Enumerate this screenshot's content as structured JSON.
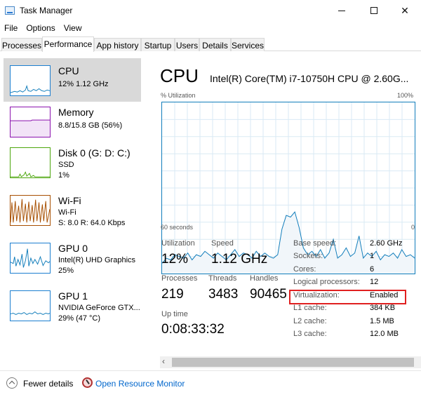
{
  "window": {
    "title": "Task Manager",
    "minimize_glyph": "minimize-icon",
    "maximize_glyph": "maximize-icon",
    "close_symbol": "✕"
  },
  "menu": [
    "File",
    "Options",
    "View"
  ],
  "tabs": [
    "Processes",
    "Performance",
    "App history",
    "Startup",
    "Users",
    "Details",
    "Services"
  ],
  "active_tab": "Performance",
  "sidebar": {
    "items": [
      {
        "name": "CPU",
        "line1": "12%  1.12 GHz",
        "color": "#117dbb"
      },
      {
        "name": "Memory",
        "line1": "8.8/15.8 GB (56%)",
        "color": "#8b12ae"
      },
      {
        "name": "Disk 0 (G: D: C:)",
        "line1": "SSD",
        "line2": "1%",
        "color": "#4da60c"
      },
      {
        "name": "Wi-Fi",
        "line1": "Wi-Fi",
        "line2": "S: 8.0  R: 64.0 Kbps",
        "color": "#a74f01"
      },
      {
        "name": "GPU 0",
        "line1": "Intel(R) UHD Graphics",
        "line2": "25%",
        "color": "#117dbb"
      },
      {
        "name": "GPU 1",
        "line1": "NVIDIA GeForce GTX...",
        "line2": "29% (47 °C)",
        "color": "#117dbb"
      }
    ]
  },
  "main": {
    "title": "CPU",
    "model": "Intel(R) Core(TM) i7-10750H CPU @ 2.60G...",
    "graph_top_left": "% Utilization",
    "graph_top_right": "100%",
    "graph_bottom_left": "60 seconds",
    "graph_bottom_right": "0",
    "stats": {
      "utilization_label": "Utilization",
      "utilization_value": "12%",
      "speed_label": "Speed",
      "speed_value": "1.12 GHz",
      "processes_label": "Processes",
      "processes_value": "219",
      "threads_label": "Threads",
      "threads_value": "3483",
      "handles_label": "Handles",
      "handles_value": "90465",
      "uptime_label": "Up time",
      "uptime_value": "0:08:33:32"
    },
    "details": [
      {
        "key": "Base speed:",
        "value": "2.60 GHz"
      },
      {
        "key": "Sockets:",
        "value": "1"
      },
      {
        "key": "Cores:",
        "value": "6"
      },
      {
        "key": "Logical processors:",
        "value": "12"
      },
      {
        "key": "Virtualization:",
        "value": "Enabled"
      },
      {
        "key": "L1 cache:",
        "value": "384 KB"
      },
      {
        "key": "L2 cache:",
        "value": "1.5 MB"
      },
      {
        "key": "L3 cache:",
        "value": "12.0 MB"
      }
    ],
    "highlight_color": "#e02020"
  },
  "footer": {
    "fewer_details": "Fewer details",
    "open_resource_monitor": "Open Resource Monitor"
  },
  "chart_data": {
    "type": "area",
    "xlim": [
      60,
      0
    ],
    "ylim": [
      0,
      100
    ],
    "xlabel": "60 seconds",
    "ylabel": "% Utilization",
    "values": [
      6,
      9,
      8,
      11,
      10,
      9,
      12,
      8,
      11,
      10,
      13,
      11,
      9,
      12,
      10,
      8,
      11,
      14,
      10,
      12,
      11,
      9,
      13,
      10,
      12,
      10,
      9,
      11,
      26,
      34,
      33,
      36,
      27,
      15,
      11,
      13,
      10,
      14,
      9,
      12,
      20,
      9,
      11,
      15,
      10,
      12,
      22,
      9,
      12,
      10,
      13,
      8,
      11,
      10,
      12,
      9,
      14,
      10,
      11,
      9
    ]
  }
}
